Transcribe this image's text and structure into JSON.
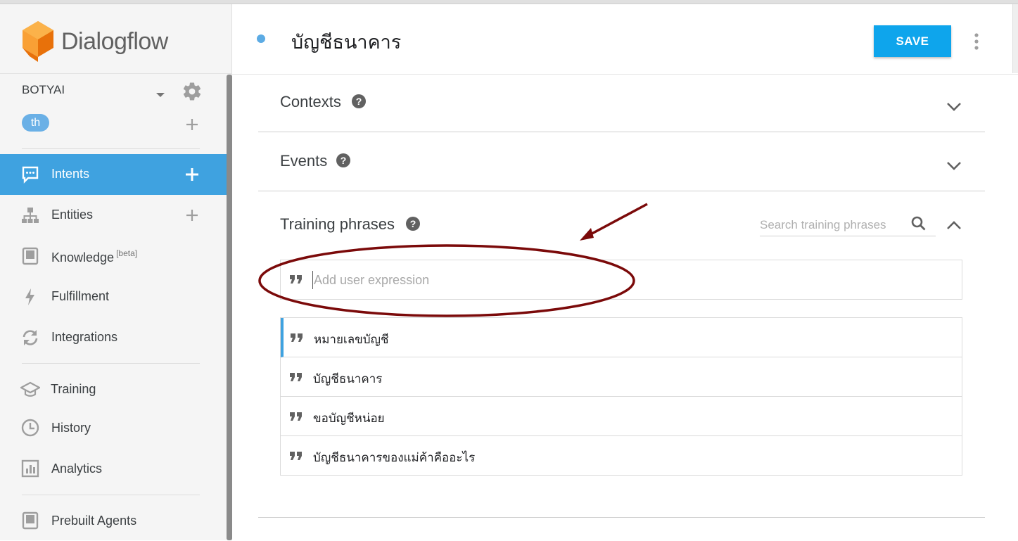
{
  "app": {
    "name": "Dialogflow"
  },
  "agent": {
    "name": "BOTYAI",
    "language_tag": "th"
  },
  "sidebar": {
    "items": [
      {
        "label": "Intents",
        "icon": "chat-icon",
        "active": true,
        "has_add": true
      },
      {
        "label": "Entities",
        "icon": "sitemap-icon",
        "active": false,
        "has_add": true
      },
      {
        "label": "Knowledge",
        "badge": "[beta]",
        "icon": "book-icon",
        "active": false
      },
      {
        "label": "Fulfillment",
        "icon": "bolt-icon",
        "active": false
      },
      {
        "label": "Integrations",
        "icon": "sync-icon",
        "active": false
      },
      {
        "label": "Training",
        "icon": "graduation-cap-icon",
        "active": false
      },
      {
        "label": "History",
        "icon": "clock-icon",
        "active": false
      },
      {
        "label": "Analytics",
        "icon": "bar-chart-icon",
        "active": false
      },
      {
        "label": "Prebuilt Agents",
        "icon": "book-icon",
        "active": false
      }
    ]
  },
  "header": {
    "intent_title": "บัญชีธนาคาร",
    "save_label": "SAVE"
  },
  "sections": {
    "contexts": {
      "title": "Contexts",
      "expanded": false
    },
    "events": {
      "title": "Events",
      "expanded": false
    },
    "training": {
      "title": "Training phrases",
      "expanded": true,
      "search_placeholder": "Search training phrases",
      "add_placeholder": "Add user expression",
      "phrases": [
        "หมายเลขบัญชี",
        "บัญชีธนาคาร",
        "ขอบัญชีหน่อย",
        "บัญชีธนาคารของแม่ค้าคืออะไร"
      ]
    }
  },
  "colors": {
    "accent": "#3fa2e0",
    "save_button": "#0ea5ec",
    "logo_orange": "#f58b1f",
    "annotation": "#7b0a0a"
  }
}
